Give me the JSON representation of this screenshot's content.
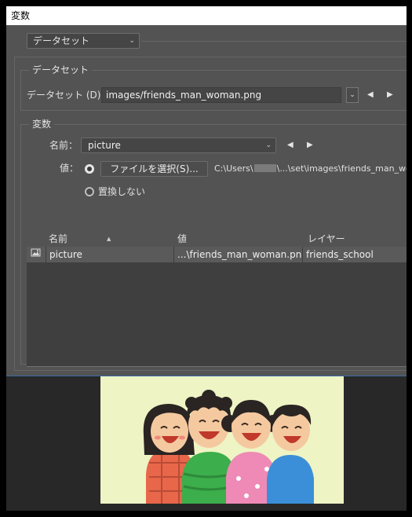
{
  "window": {
    "title": "変数"
  },
  "top_select": {
    "value": "データセット"
  },
  "dataset_group": {
    "label": "データセット",
    "field_label": "データセット (D)：",
    "field_value": "images/friends_man_woman.png"
  },
  "variables_group": {
    "label": "変数",
    "name_label": "名前：",
    "name_value": "picture",
    "value_label": "値：",
    "choose_file_button": "ファイルを選択(S)...",
    "path_prefix": "C:\\Users\\",
    "path_suffix": "\\...\\set\\images\\friends_man_woma",
    "no_replace_label": "置換しない"
  },
  "table": {
    "headers": {
      "name": "名前",
      "value": "値",
      "layer": "レイヤー"
    },
    "rows": [
      {
        "name": "picture",
        "value": "...\\friends_man_woman.png",
        "layer": "friends_school"
      }
    ]
  },
  "colors": {
    "panel": "#535353",
    "canvas": "#282828",
    "image_bg": "#eef4c4"
  }
}
